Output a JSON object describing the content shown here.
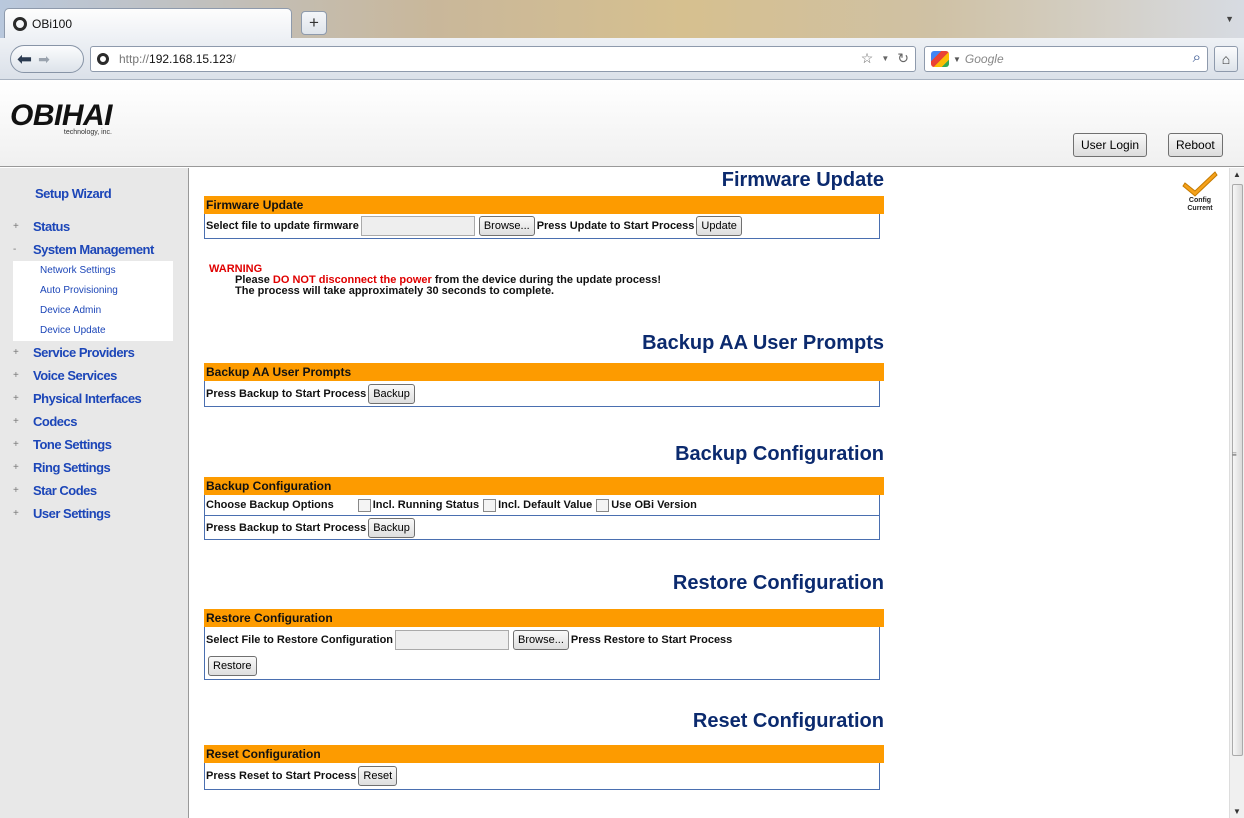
{
  "browser": {
    "tab_title": "OBi100",
    "new_tab": "+",
    "url_prefix": "http://",
    "url_host": "192.168.15.123",
    "url_suffix": "/",
    "search_placeholder": "Google"
  },
  "header": {
    "logo": "OBIHAI",
    "logo_sub": "technology, inc.",
    "user_login": "User Login",
    "reboot": "Reboot"
  },
  "sidebar": {
    "wizard": "Setup Wizard",
    "items": [
      {
        "exp": "+",
        "label": "Status"
      },
      {
        "exp": "-",
        "label": "System Management"
      },
      {
        "exp": "+",
        "label": "Service Providers"
      },
      {
        "exp": "+",
        "label": "Voice Services"
      },
      {
        "exp": "+",
        "label": "Physical Interfaces"
      },
      {
        "exp": "+",
        "label": "Codecs"
      },
      {
        "exp": "+",
        "label": "Tone Settings"
      },
      {
        "exp": "+",
        "label": "Ring Settings"
      },
      {
        "exp": "+",
        "label": "Star Codes"
      },
      {
        "exp": "+",
        "label": "User Settings"
      }
    ],
    "subitems": [
      "Network Settings",
      "Auto Provisioning",
      "Device Admin",
      "Device Update"
    ]
  },
  "config_status": {
    "line1": "Config",
    "line2": "Current"
  },
  "firmware": {
    "title": "Firmware Update",
    "bar": "Firmware Update",
    "select_label": "Select file to update firmware",
    "browse": "Browse...",
    "press_label": "Press Update to Start Process",
    "update": "Update",
    "warning_head": "WARNING",
    "warn_pre": "Please ",
    "warn_red": "DO NOT disconnect the power",
    "warn_post": " from the device during the update process!",
    "warn_line2": "The process will take approximately 30 seconds to complete."
  },
  "backup_aa": {
    "title": "Backup AA User Prompts",
    "bar": "Backup AA User Prompts",
    "press_label": "Press Backup to Start Process",
    "backup": "Backup"
  },
  "backup_config": {
    "title": "Backup Configuration",
    "bar": "Backup Configuration",
    "choose_label": "Choose Backup Options",
    "opt_running": "Incl. Running Status",
    "opt_default": "Incl. Default Value",
    "opt_obi": "Use OBi Version",
    "press_label": "Press Backup to Start Process",
    "backup": "Backup"
  },
  "restore": {
    "title": "Restore Configuration",
    "bar": "Restore Configuration",
    "select_label": "Select File to Restore Configuration",
    "browse": "Browse...",
    "press_label": "Press Restore to Start Process",
    "restore": "Restore"
  },
  "reset": {
    "title": "Reset Configuration",
    "bar": "Reset Configuration",
    "press_label": "Press Reset to Start Process",
    "reset": "Reset"
  }
}
